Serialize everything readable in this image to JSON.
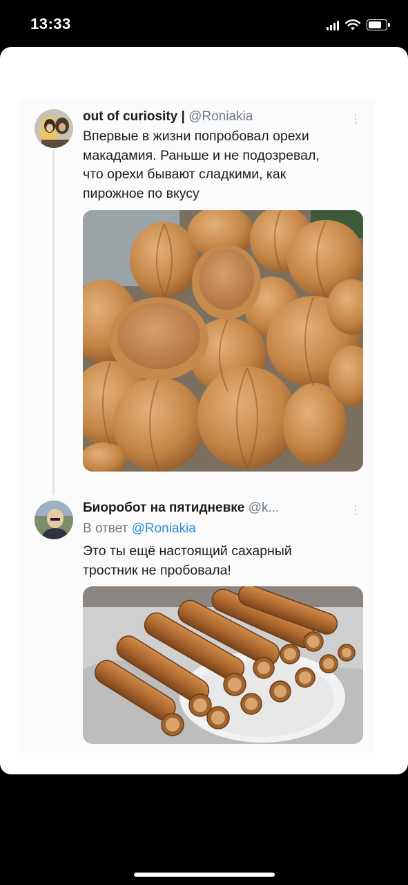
{
  "status_bar": {
    "time": "13:33"
  },
  "tweets": [
    {
      "author_name": "out of curiosity |",
      "author_handle": "@Roniakia",
      "text_lines": [
        "Впервые в жизни попробовал орехи",
        "макадамия. Раньше и не подозревал,",
        "что орехи бывают сладкими, как",
        "пирожное по вкусу"
      ]
    },
    {
      "author_name": "Биоробот на пятидневке",
      "author_handle": "@k...",
      "reply_prefix": "В ответ",
      "reply_handle": "@Roniakia",
      "text_lines": [
        "Это ты ещё настоящий сахарный",
        "тростник не пробовала!"
      ]
    }
  ],
  "colors": {
    "link": "#2b8ed6",
    "secondary_text": "#6e7a85",
    "primary_text": "#1b1b1b"
  }
}
